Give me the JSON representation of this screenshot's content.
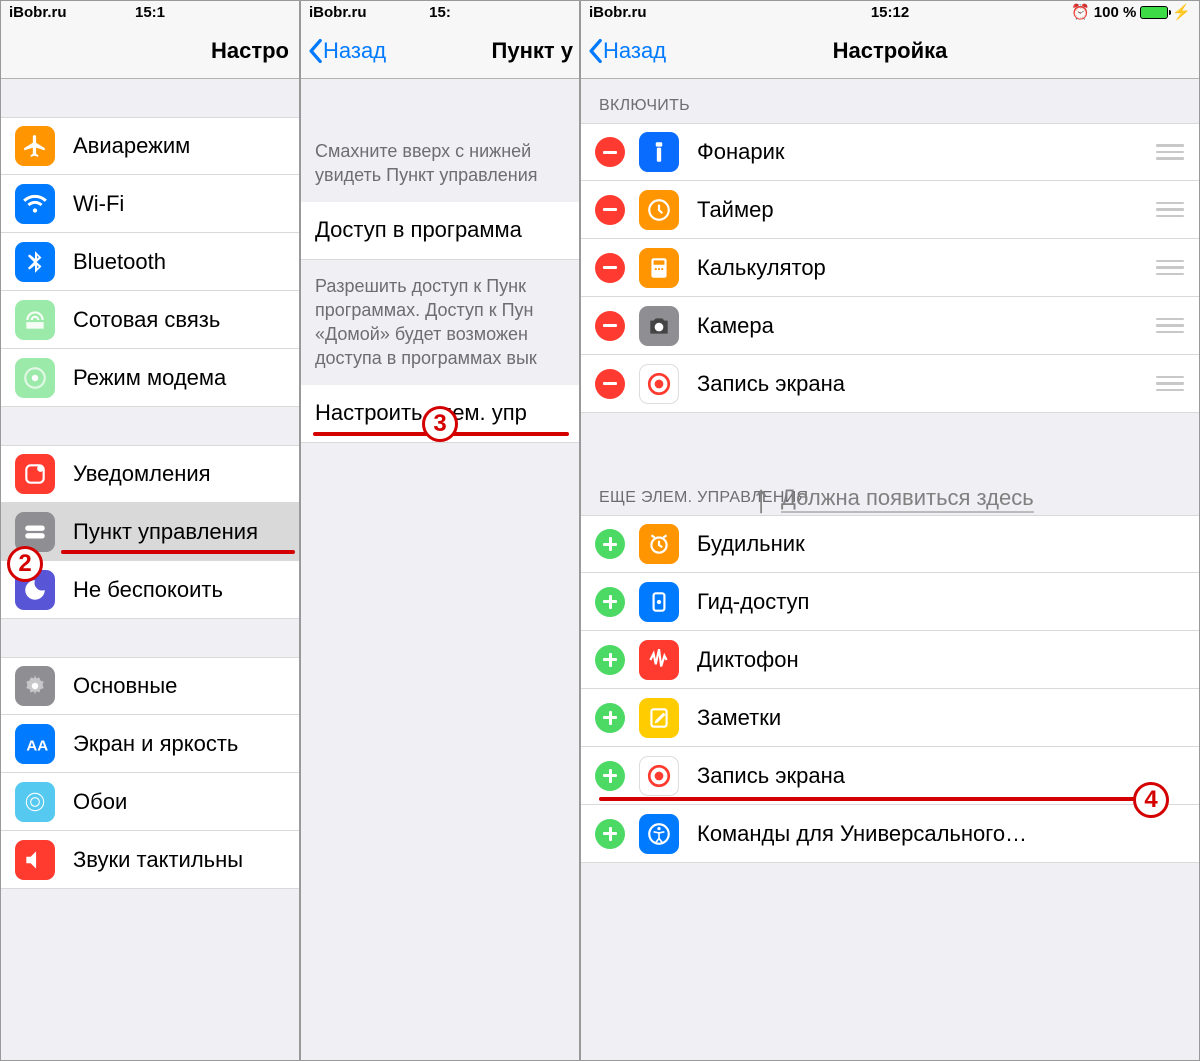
{
  "status": {
    "site": "iBobr.ru",
    "time1": "15:1",
    "time2": "15:",
    "time3": "15:12",
    "batt": "100 %"
  },
  "s1": {
    "title": "Настро",
    "rows": [
      {
        "key": "airplane",
        "label": "Авиарежим",
        "bg": "#ff9500"
      },
      {
        "key": "wifi",
        "label": "Wi-Fi",
        "bg": "#007aff"
      },
      {
        "key": "bluetooth",
        "label": "Bluetooth",
        "bg": "#007aff"
      },
      {
        "key": "cellular",
        "label": "Сотовая связь",
        "bg": "#4cd964",
        "faded": true
      },
      {
        "key": "hotspot",
        "label": "Режим модема",
        "bg": "#4cd964",
        "faded": true
      }
    ],
    "rows2": [
      {
        "key": "notifications",
        "label": "Уведомления",
        "bg": "#ff3b30"
      },
      {
        "key": "controlcenter",
        "label": "Пункт управления",
        "bg": "#8e8e93",
        "highlight": true
      },
      {
        "key": "dnd",
        "label": "Не беспокоить",
        "bg": "#5856d6"
      }
    ],
    "rows3": [
      {
        "key": "general",
        "label": "Основные",
        "bg": "#8e8e93"
      },
      {
        "key": "display",
        "label": "Экран и яркость",
        "bg": "#007aff"
      },
      {
        "key": "wallpaper",
        "label": "Обои",
        "bg": "#55c9ef"
      },
      {
        "key": "sounds",
        "label": "Звуки  тактильны",
        "bg": "#ff3b30"
      }
    ]
  },
  "s2": {
    "back": "Назад",
    "title": "Пункт у",
    "desc1": "Смахните вверх с нижней увидеть Пункт управления",
    "row_access": "Доступ в программа",
    "desc2": "Разрешить доступ к Пунк программах. Доступ к Пун «Домой» будет возможен доступа в программах вык",
    "row_customize": "Настроить элем. упр"
  },
  "s3": {
    "back": "Назад",
    "title": "Настройка",
    "section_include": "ВКЛЮЧИТЬ",
    "include": [
      {
        "key": "flashlight",
        "label": "Фонарик",
        "bg": "#0a6cff"
      },
      {
        "key": "timer",
        "label": "Таймер",
        "bg": "#ff9500"
      },
      {
        "key": "calculator",
        "label": "Калькулятор",
        "bg": "#ff9500"
      },
      {
        "key": "camera",
        "label": "Камера",
        "bg": "#8e8e93"
      },
      {
        "key": "screenrec",
        "label": "Запись экрана",
        "bg": "#ffffff"
      }
    ],
    "annotation": "Должна появиться здесь",
    "section_more": "ЕЩЕ ЭЛЕМ. УПРАВЛЕНИЯ",
    "more": [
      {
        "key": "alarm",
        "label": "Будильник",
        "bg": "#ff9500"
      },
      {
        "key": "guided",
        "label": "Гид-доступ",
        "bg": "#007aff"
      },
      {
        "key": "voice",
        "label": "Диктофон",
        "bg": "#ff3b30"
      },
      {
        "key": "notes",
        "label": "Заметки",
        "bg": "#ffcc00"
      },
      {
        "key": "screenrec2",
        "label": "Запись экрана",
        "bg": "#ffffff"
      },
      {
        "key": "accessibility",
        "label": "Команды для Универсального…",
        "bg": "#007aff"
      }
    ]
  },
  "badges": {
    "b2": "2",
    "b3": "3",
    "b4": "4"
  }
}
